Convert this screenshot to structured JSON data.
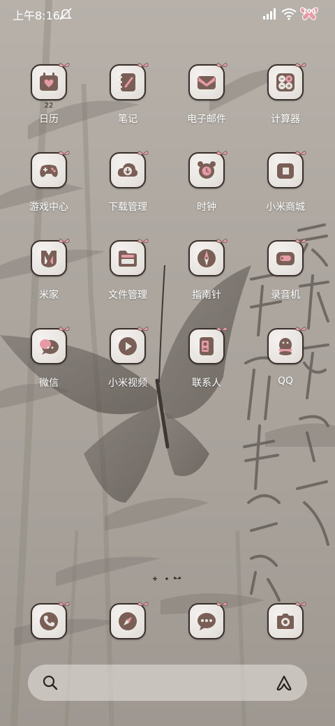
{
  "status_bar": {
    "time": "上午8:16",
    "battery_level": "100"
  },
  "apps": [
    {
      "label": "日历",
      "icon": "calendar-icon",
      "date": "22"
    },
    {
      "label": "笔记",
      "icon": "notebook-icon"
    },
    {
      "label": "电子邮件",
      "icon": "envelope-icon"
    },
    {
      "label": "计算器",
      "icon": "calculator-icon"
    },
    {
      "label": "游戏中心",
      "icon": "gamepad-icon"
    },
    {
      "label": "下载管理",
      "icon": "cloud-download-icon"
    },
    {
      "label": "时钟",
      "icon": "alarm-clock-icon"
    },
    {
      "label": "小米商城",
      "icon": "shopping-bag-icon"
    },
    {
      "label": "米家",
      "icon": "mijia-icon"
    },
    {
      "label": "文件管理",
      "icon": "folder-icon"
    },
    {
      "label": "指南针",
      "icon": "compass-icon"
    },
    {
      "label": "录音机",
      "icon": "recorder-icon"
    },
    {
      "label": "微信",
      "icon": "chat-bubbles-icon"
    },
    {
      "label": "小米视频",
      "icon": "play-icon"
    },
    {
      "label": "联系人",
      "icon": "contact-card-icon"
    },
    {
      "label": "QQ",
      "icon": "penguin-icon"
    }
  ],
  "dock": [
    {
      "icon": "phone-icon"
    },
    {
      "icon": "browser-compass-icon"
    },
    {
      "icon": "message-bubble-icon"
    },
    {
      "icon": "camera-icon"
    }
  ],
  "wallpaper_calligraphy": [
    "云想衣裳花想容",
    "春风拂槛露华浓"
  ],
  "colors": {
    "icon_glyph": "#7a5f57",
    "icon_accent": "#e59aa6",
    "icon_border": "#3a2e2b"
  }
}
